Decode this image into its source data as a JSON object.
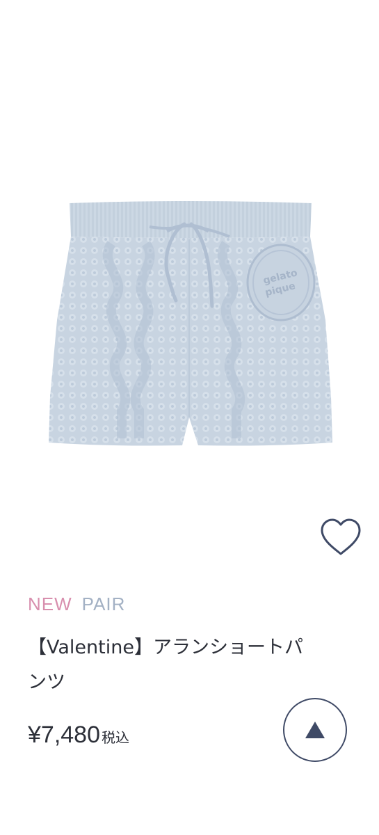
{
  "product": {
    "image_alt": "gelato pique cable knit short pants",
    "logo_lines": [
      "gelato",
      "pique"
    ],
    "tags": [
      "NEW",
      "PAIR"
    ],
    "title": "【Valentine】アランショートパンツ",
    "price": "¥7,480",
    "tax_label": "税込"
  },
  "icons": {
    "favorite": "heart-outline-icon",
    "scroll_top": "triangle-up-icon"
  },
  "colors": {
    "tag_new": "#d88fae",
    "tag_pair": "#a3b1c4",
    "accent": "#3f4a66",
    "garment": "#c9d5e2"
  }
}
